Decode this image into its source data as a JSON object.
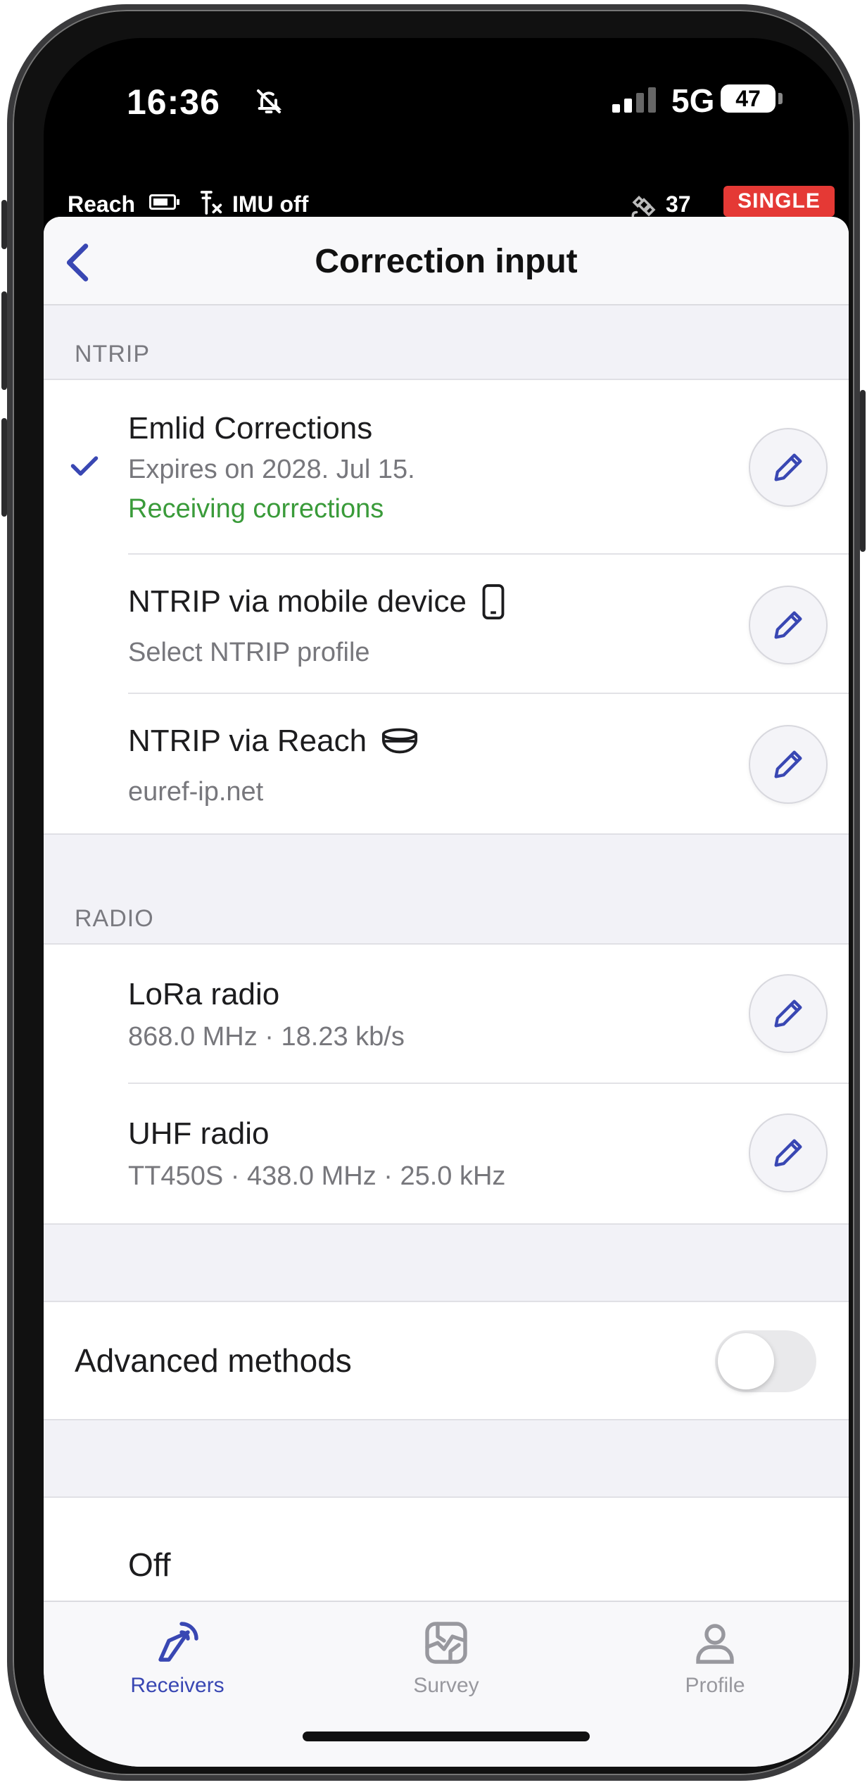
{
  "status_bar": {
    "time": "16:36",
    "network": "5G",
    "battery": "47"
  },
  "device_bar": {
    "device_name": "Reach",
    "imu_status": "IMU off",
    "satellite_count": "37",
    "solution_status": "SINGLE"
  },
  "navbar": {
    "title": "Correction input"
  },
  "ntrip": {
    "section_label": "NTRIP",
    "items": [
      {
        "title": "Emlid Corrections",
        "subtitle": "Expires on 2028. Jul 15.",
        "status": "Receiving corrections",
        "selected": true
      },
      {
        "title": "NTRIP via mobile device",
        "subtitle": "Select NTRIP profile",
        "icon": "phone-icon"
      },
      {
        "title": "NTRIP via Reach",
        "subtitle": "euref-ip.net",
        "icon": "reach-receiver-icon"
      }
    ]
  },
  "radio": {
    "section_label": "RADIO",
    "items": [
      {
        "title": "LoRa radio",
        "subtitle": "868.0 MHz · 18.23 kb/s"
      },
      {
        "title": "UHF radio",
        "subtitle": "TT450S · 438.0 MHz · 25.0 kHz"
      }
    ]
  },
  "advanced": {
    "label": "Advanced methods",
    "enabled": false
  },
  "off_option": {
    "label": "Off"
  },
  "tabbar": {
    "tabs": [
      {
        "label": "Receivers",
        "active": true
      },
      {
        "label": "Survey",
        "active": false
      },
      {
        "label": "Profile",
        "active": false
      }
    ]
  },
  "colors": {
    "accent": "#3947b3",
    "status_ok": "#3a9b3a",
    "badge_red": "#e53935"
  }
}
